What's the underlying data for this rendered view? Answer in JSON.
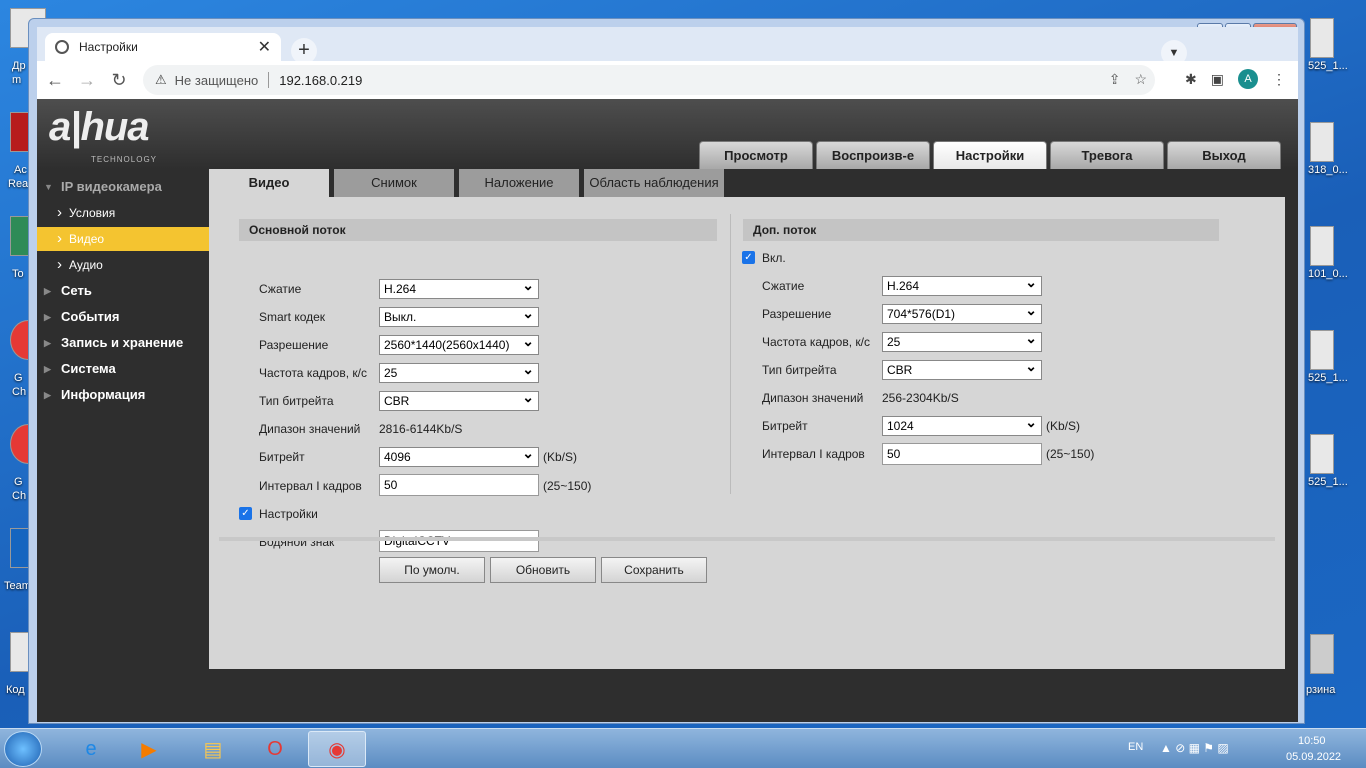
{
  "desktop": {
    "left_labels": [
      "Др",
      "m",
      "Ac",
      "Rea",
      "To",
      "G",
      "Ch",
      "G",
      "Ch",
      "Team",
      "Код"
    ],
    "right_labels": [
      "525_1...",
      "318_0...",
      "101_0...",
      "525_1...",
      "525_1...",
      "рзина"
    ]
  },
  "browser": {
    "tab_title": "Настройки",
    "tab_close": "✕",
    "new_tab": "+",
    "insecure_label": "Не защищено",
    "url": "192.168.0.219",
    "avatar_letter": "A",
    "window_controls": [
      "—",
      "▭",
      "✕"
    ]
  },
  "app": {
    "logo": "a|hua",
    "logo_sub": "TECHNOLOGY",
    "main_tabs": [
      "Просмотр",
      "Воспроизв-е",
      "Настройки",
      "Тревога",
      "Выход"
    ],
    "active_main_tab": "Настройки",
    "sidebar": {
      "items": [
        {
          "label": "IP видеокамера",
          "type": "top",
          "open": true
        },
        {
          "label": "Условия",
          "type": "sub"
        },
        {
          "label": "Видео",
          "type": "sub",
          "selected": true
        },
        {
          "label": "Аудио",
          "type": "sub"
        },
        {
          "label": "Сеть",
          "type": "top"
        },
        {
          "label": "События",
          "type": "top"
        },
        {
          "label": "Запись и хранение",
          "type": "top"
        },
        {
          "label": "Система",
          "type": "top"
        },
        {
          "label": "Информация",
          "type": "top"
        }
      ]
    },
    "sub_tabs": [
      "Видео",
      "Снимок",
      "Наложение",
      "Область наблюдения"
    ],
    "main_stream": {
      "header": "Основной поток",
      "compression_label": "Сжатие",
      "compression": "H.264",
      "smart_label": "Smart кодек",
      "smart": "Выкл.",
      "resolution_label": "Разрешение",
      "resolution": "2560*1440(2560x1440)",
      "fps_label": "Частота кадров, к/с",
      "fps": "25",
      "bitrate_type_label": "Тип битрейта",
      "bitrate_type": "CBR",
      "range_label": "Дипазон значений",
      "range": "2816-6144Kb/S",
      "bitrate_label": "Битрейт",
      "bitrate": "4096",
      "bitrate_unit": "(Kb/S)",
      "iframe_label": "Интервал I кадров",
      "iframe": "50",
      "iframe_range": "(25~150)",
      "watermark_settings_label": "Настройки",
      "watermark_label": "Водяной знак",
      "watermark": "DigitalCCTV"
    },
    "sub_stream": {
      "header": "Доп. поток",
      "enable_label": "Вкл.",
      "compression_label": "Сжатие",
      "compression": "H.264",
      "resolution_label": "Разрешение",
      "resolution": "704*576(D1)",
      "fps_label": "Частота кадров, к/с",
      "fps": "25",
      "bitrate_type_label": "Тип битрейта",
      "bitrate_type": "CBR",
      "range_label": "Дипазон значений",
      "range": "256-2304Kb/S",
      "bitrate_label": "Битрейт",
      "bitrate": "1024",
      "bitrate_unit": "(Kb/S)",
      "iframe_label": "Интервал I кадров",
      "iframe": "50",
      "iframe_range": "(25~150)"
    },
    "buttons": {
      "default": "По умолч.",
      "refresh": "Обновить",
      "save": "Сохранить"
    }
  },
  "taskbar": {
    "lang": "EN",
    "time": "10:50",
    "date": "05.09.2022"
  }
}
